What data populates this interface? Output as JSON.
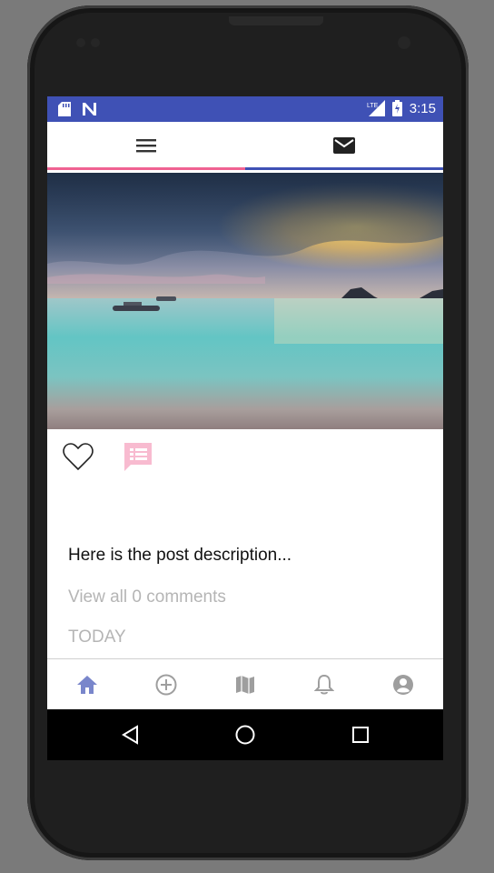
{
  "status_bar": {
    "time": "3:15",
    "network": "LTE"
  },
  "top_tabs": [
    {
      "icon": "menu-icon"
    },
    {
      "icon": "mail-icon"
    }
  ],
  "post": {
    "liked": false,
    "description": "Here is the post description...",
    "comments_link": "View all 0 comments",
    "date": "TODAY"
  },
  "bottom_nav": [
    {
      "icon": "home-icon",
      "active": true
    },
    {
      "icon": "add-circle-icon",
      "active": false
    },
    {
      "icon": "map-icon",
      "active": false
    },
    {
      "icon": "bell-icon",
      "active": false
    },
    {
      "icon": "account-icon",
      "active": false
    }
  ],
  "colors": {
    "primary": "#3f51b5",
    "accent": "#f06292",
    "nav_active": "#7986cb",
    "nav_inactive": "#9e9e9e",
    "comment_icon": "#f8bbd0"
  }
}
